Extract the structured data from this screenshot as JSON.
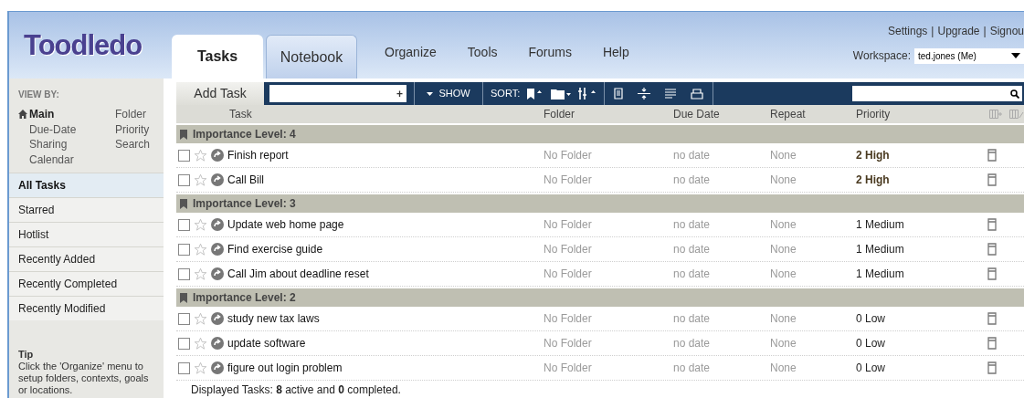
{
  "logo": "Toodledo",
  "header_links": [
    "Settings",
    "Upgrade",
    "Signou"
  ],
  "header_separator": "|",
  "tabs": [
    {
      "label": "Tasks",
      "selected": true
    },
    {
      "label": "Notebook",
      "selected": false
    }
  ],
  "nav": [
    "Organize",
    "Tools",
    "Forums",
    "Help"
  ],
  "workspace": {
    "label": "Workspace:",
    "value": "ted.jones (Me)"
  },
  "sidebar": {
    "view_by_title": "VIEW BY:",
    "view_by": [
      {
        "label": "Main",
        "selected": true
      },
      {
        "label": "Folder",
        "selected": false
      },
      {
        "label": "Due-Date",
        "selected": false
      },
      {
        "label": "Priority",
        "selected": false
      },
      {
        "label": "Sharing",
        "selected": false
      },
      {
        "label": "Search",
        "selected": false
      },
      {
        "label": "Calendar",
        "selected": false
      }
    ],
    "items": [
      {
        "label": "All Tasks",
        "selected": true
      },
      {
        "label": "Starred",
        "selected": false
      },
      {
        "label": "Hotlist",
        "selected": false
      },
      {
        "label": "Recently Added",
        "selected": false
      },
      {
        "label": "Recently Completed",
        "selected": false
      },
      {
        "label": "Recently Modified",
        "selected": false
      }
    ],
    "tip": {
      "title": "Tip",
      "text": "Click the 'Organize' menu to setup folders, contexts, goals or locations."
    }
  },
  "toolbar": {
    "add_task": "Add Task",
    "add_symbol": "+",
    "show": "SHOW",
    "sort": "SORT:"
  },
  "table": {
    "columns": [
      "Task",
      "Folder",
      "Due Date",
      "Repeat",
      "Priority"
    ],
    "groups": [
      {
        "title": "Importance Level: 4",
        "tasks": [
          {
            "title": "Finish report",
            "checked": false,
            "starred": false,
            "folder": "No Folder",
            "due": "no date",
            "repeat": "None",
            "priority": "2 High",
            "priority_bold": true
          },
          {
            "title": "Call Bill",
            "checked": false,
            "starred": false,
            "folder": "No Folder",
            "due": "no date",
            "repeat": "None",
            "priority": "2 High",
            "priority_bold": true
          }
        ]
      },
      {
        "title": "Importance Level: 3",
        "tasks": [
          {
            "title": "Update web home page",
            "checked": false,
            "starred": false,
            "folder": "No Folder",
            "due": "no date",
            "repeat": "None",
            "priority": "1 Medium",
            "priority_bold": false
          },
          {
            "title": "Find exercise guide",
            "checked": false,
            "starred": false,
            "folder": "No Folder",
            "due": "no date",
            "repeat": "None",
            "priority": "1 Medium",
            "priority_bold": false
          },
          {
            "title": "Call Jim about deadline reset",
            "checked": false,
            "starred": false,
            "folder": "No Folder",
            "due": "no date",
            "repeat": "None",
            "priority": "1 Medium",
            "priority_bold": false
          }
        ]
      },
      {
        "title": "Importance Level: 2",
        "tasks": [
          {
            "title": "study new tax laws",
            "checked": false,
            "starred": false,
            "folder": "No Folder",
            "due": "no date",
            "repeat": "None",
            "priority": "0 Low",
            "priority_bold": false
          },
          {
            "title": "update software",
            "checked": false,
            "starred": false,
            "folder": "No Folder",
            "due": "no date",
            "repeat": "None",
            "priority": "0 Low",
            "priority_bold": false
          },
          {
            "title": "figure out login problem",
            "checked": false,
            "starred": false,
            "folder": "No Folder",
            "due": "no date",
            "repeat": "None",
            "priority": "0 Low",
            "priority_bold": false
          }
        ]
      }
    ]
  },
  "footer": "Displayed Tasks: **8** active and **0** completed."
}
